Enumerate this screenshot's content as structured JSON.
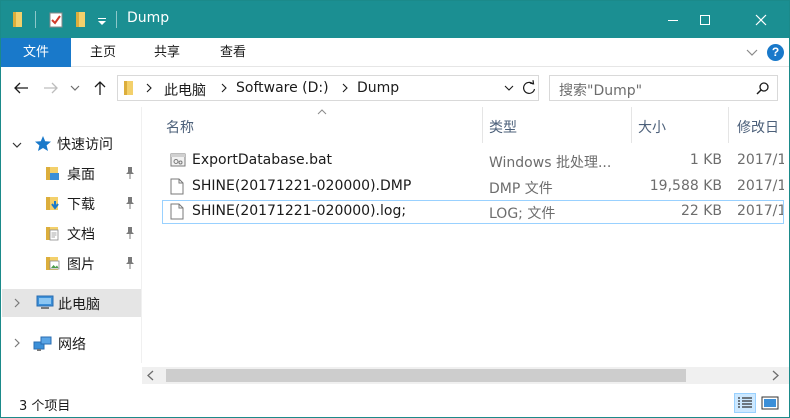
{
  "window": {
    "title": "Dump",
    "colors": {
      "titlebar": "#1b8f92",
      "file_tab": "#1979ca",
      "selection": "#cce8ff"
    }
  },
  "ribbon": {
    "tabs": [
      {
        "label": "文件",
        "active": true
      },
      {
        "label": "主页"
      },
      {
        "label": "共享"
      },
      {
        "label": "查看"
      }
    ],
    "help": "?"
  },
  "address": {
    "crumbs": [
      "此电脑",
      "Software (D:)",
      "Dump"
    ]
  },
  "search": {
    "placeholder": "搜索\"Dump\""
  },
  "navpane": {
    "quick_access": "快速访问",
    "pinned": [
      {
        "label": "桌面",
        "icon": "desktop-folder-icon"
      },
      {
        "label": "下载",
        "icon": "downloads-folder-icon"
      },
      {
        "label": "文档",
        "icon": "documents-folder-icon"
      },
      {
        "label": "图片",
        "icon": "pictures-folder-icon"
      }
    ],
    "this_pc": "此电脑",
    "network": "网络"
  },
  "filelist": {
    "columns": {
      "name": "名称",
      "type": "类型",
      "size": "大小",
      "modified": "修改日"
    },
    "rows": [
      {
        "name": "ExportDatabase.bat",
        "type": "Windows 批处理...",
        "size": "1 KB",
        "modified": "2017/1",
        "icon": "batch-file-icon"
      },
      {
        "name": "SHINE(20171221-020000).DMP",
        "type": "DMP 文件",
        "size": "19,588 KB",
        "modified": "2017/1",
        "icon": "file-icon"
      },
      {
        "name": "SHINE(20171221-020000).log;",
        "type": "LOG; 文件",
        "size": "22 KB",
        "modified": "2017/1",
        "icon": "file-icon",
        "focused": true
      }
    ]
  },
  "status": {
    "count": "3 个项目"
  }
}
